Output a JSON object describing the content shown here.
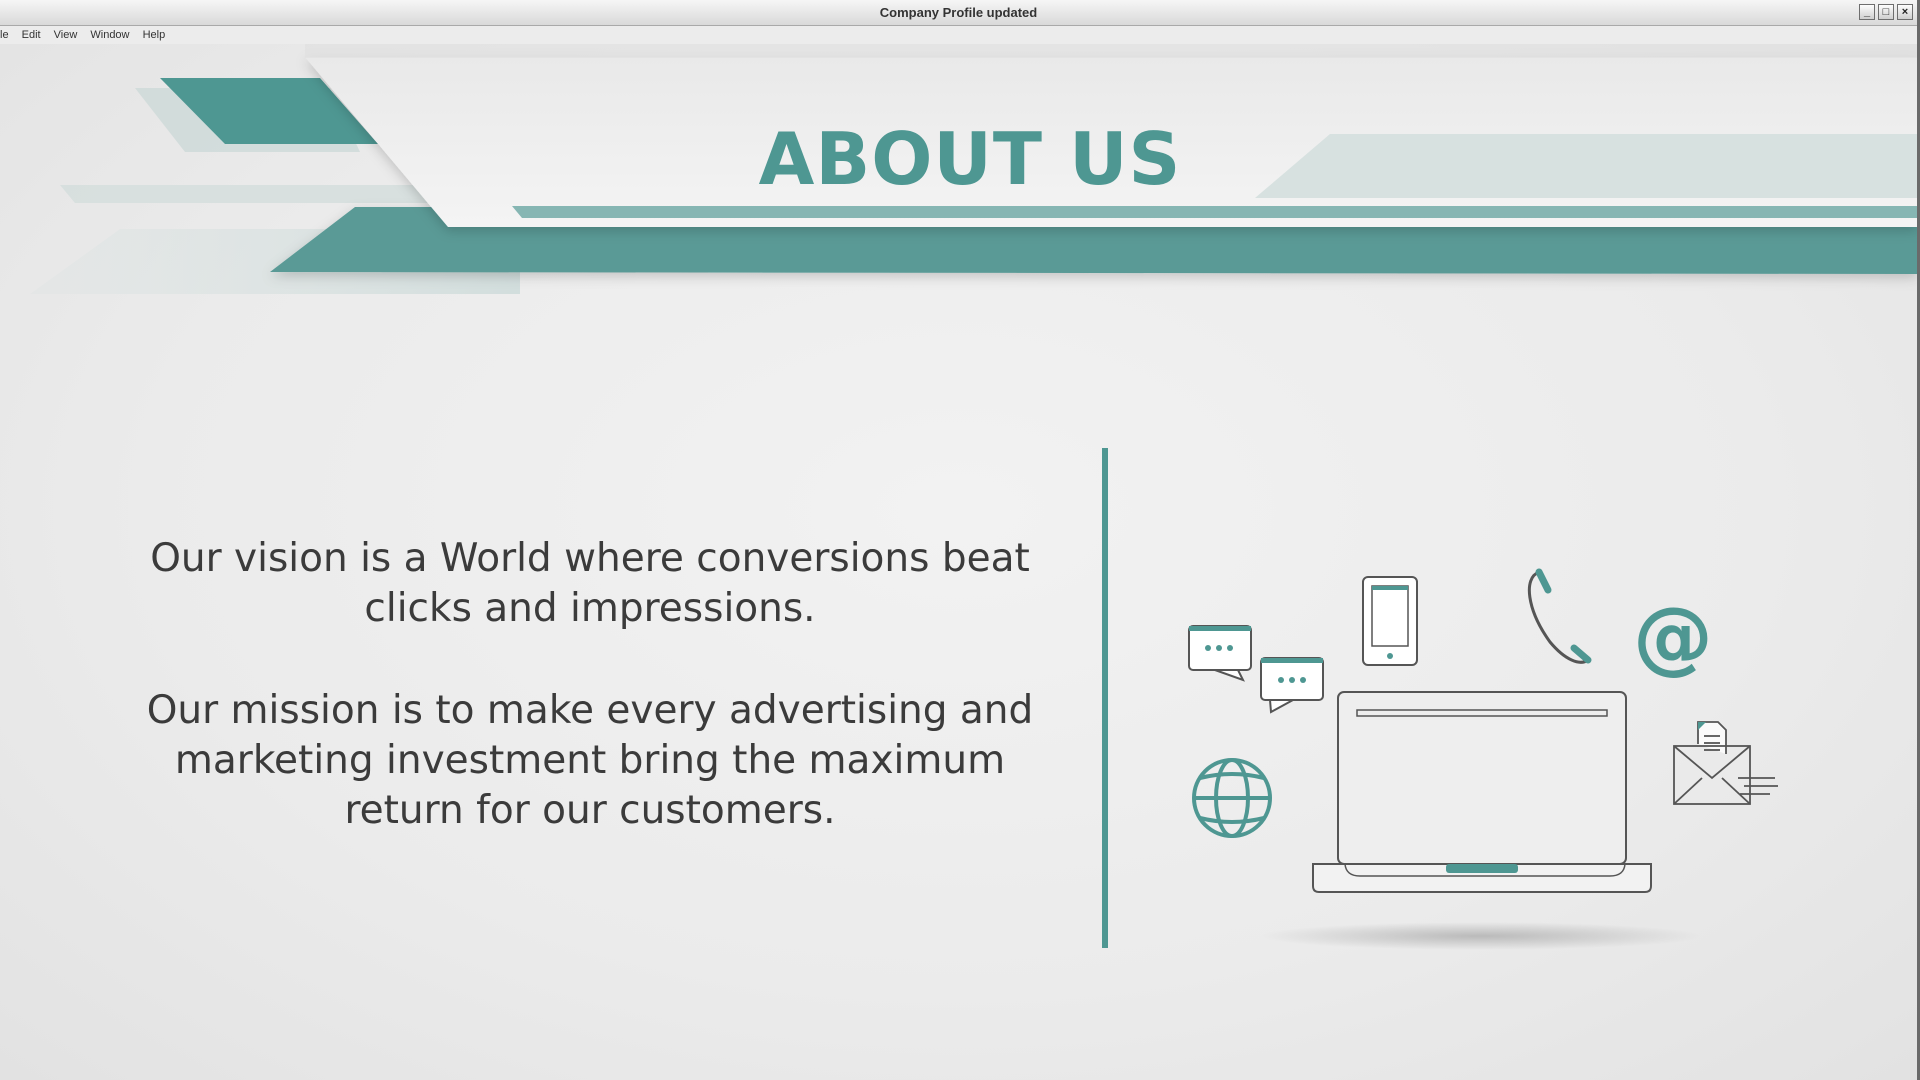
{
  "window": {
    "title": "Company Profile updated",
    "controls": [
      "minimize-icon",
      "maximize-icon",
      "close-icon"
    ]
  },
  "menu": {
    "items": [
      "le",
      "Edit",
      "View",
      "Window",
      "Help"
    ]
  },
  "slide": {
    "title": "ABOUT US",
    "vision": "Our vision is a World where conversions beat clicks and impressions.",
    "mission": "Our mission is to make every advertising and marketing investment bring the maximum return for our customers."
  },
  "illustration": {
    "icons": [
      "chat-bubble-icon",
      "chat-bubble-icon",
      "smartphone-icon",
      "phone-handset-icon",
      "at-sign-icon",
      "globe-icon",
      "laptop-icon",
      "envelope-icon"
    ],
    "at_symbol": "@"
  },
  "colors": {
    "accent": "#4e9792",
    "accent_light": "#9cc4c1",
    "text": "#3b3b3b",
    "background": "#ececec"
  }
}
